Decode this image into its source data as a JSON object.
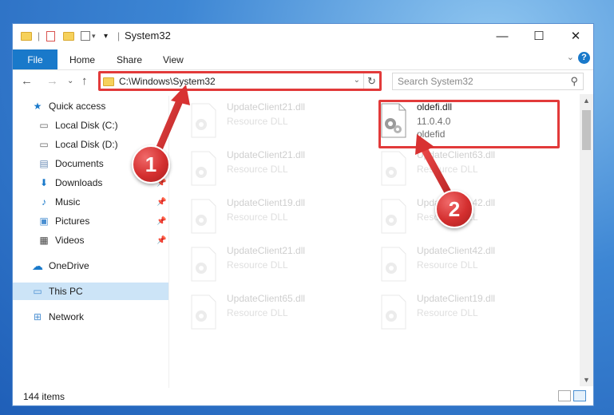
{
  "window": {
    "title": "System32",
    "controls": {
      "minimize": "—",
      "maximize": "☐",
      "close": "✕"
    }
  },
  "ribbon": {
    "tabs": [
      "File",
      "Home",
      "Share",
      "View"
    ],
    "help": "?",
    "collapse": "⌄"
  },
  "address": {
    "path": "C:\\Windows\\System32",
    "dropdown": "⌄",
    "refresh": "↻"
  },
  "nav_buttons": {
    "back": "←",
    "forward": "→",
    "recent": "⌄",
    "up": "↑"
  },
  "search": {
    "placeholder": "Search System32",
    "icon": "⚲"
  },
  "nav_pane": [
    {
      "label": "Quick access",
      "icon": "star-icon",
      "glyph": "★",
      "pinned": false
    },
    {
      "label": "Local Disk (C:)",
      "icon": "drive-icon",
      "glyph": "▭",
      "pinned": true
    },
    {
      "label": "Local Disk (D:)",
      "icon": "drive-icon",
      "glyph": "▭",
      "pinned": true
    },
    {
      "label": "Documents",
      "icon": "documents-icon",
      "glyph": "▤",
      "pinned": true
    },
    {
      "label": "Downloads",
      "icon": "downloads-icon",
      "glyph": "⬇",
      "pinned": true
    },
    {
      "label": "Music",
      "icon": "music-icon",
      "glyph": "♪",
      "pinned": true
    },
    {
      "label": "Pictures",
      "icon": "pictures-icon",
      "glyph": "▣",
      "pinned": true
    },
    {
      "label": "Videos",
      "icon": "videos-icon",
      "glyph": "▦",
      "pinned": true
    },
    {
      "label": "OneDrive",
      "icon": "onedrive-icon",
      "glyph": "☁",
      "pinned": false
    },
    {
      "label": "This PC",
      "icon": "computer-icon",
      "glyph": "▭",
      "pinned": false
    },
    {
      "label": "Network",
      "icon": "network-icon",
      "glyph": "⊞",
      "pinned": false
    }
  ],
  "files": {
    "left_column": [
      {
        "name": "UpdateClient21.dll",
        "type": "Resource DLL"
      },
      {
        "name": "UpdateClient21.dll",
        "type": "Resource DLL"
      },
      {
        "name": "UpdateClient19.dll",
        "type": "Resource DLL"
      },
      {
        "name": "UpdateClient21.dll",
        "type": "Resource DLL"
      },
      {
        "name": "UpdateClient65.dll",
        "type": "Resource DLL"
      }
    ],
    "right_column": [
      {
        "name": "oldefi.dll",
        "version": "11.0.4.0",
        "company": "oldefid"
      },
      {
        "name": "UpdateClient63.dll",
        "type": "Resource DLL"
      },
      {
        "name": "UpdateClient42.dll",
        "type": "Resource DLL"
      },
      {
        "name": "UpdateClient42.dll",
        "type": "Resource DLL"
      },
      {
        "name": "UpdateClient19.dll",
        "type": "Resource DLL"
      }
    ]
  },
  "status": {
    "count": "144 items"
  },
  "callouts": [
    {
      "label": "1"
    },
    {
      "label": "2"
    }
  ],
  "colors": {
    "accent": "#1979ca",
    "highlight": "#e23a3a",
    "selected": "#cce4f7"
  }
}
